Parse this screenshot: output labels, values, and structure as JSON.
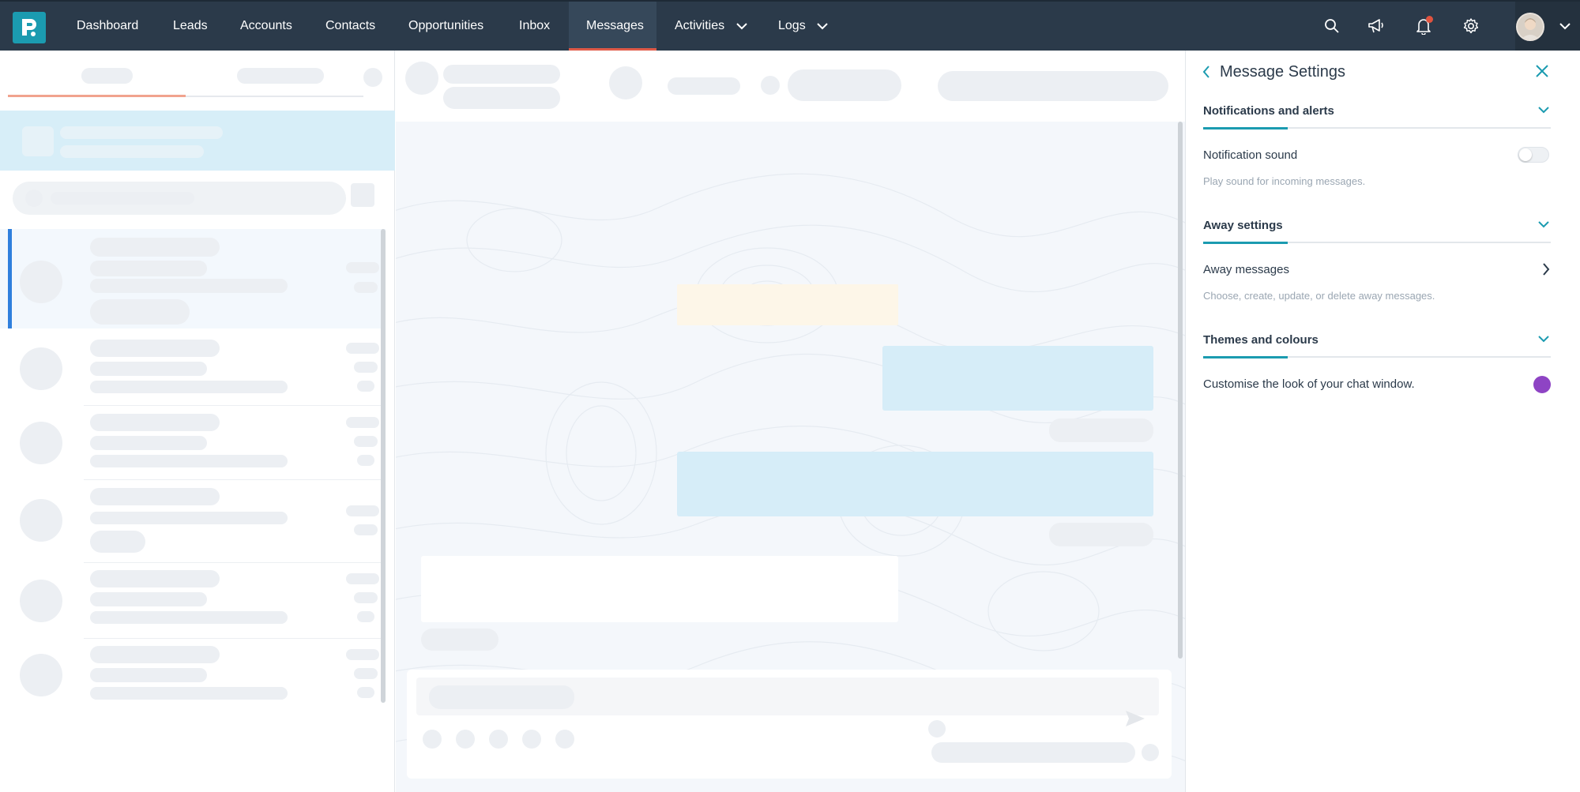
{
  "nav": {
    "items": [
      {
        "label": "Dashboard"
      },
      {
        "label": "Leads"
      },
      {
        "label": "Accounts"
      },
      {
        "label": "Contacts"
      },
      {
        "label": "Opportunities"
      },
      {
        "label": "Inbox"
      },
      {
        "label": "Messages",
        "active": true
      },
      {
        "label": "Activities",
        "dropdown": true
      },
      {
        "label": "Logs",
        "dropdown": true
      }
    ],
    "icons": [
      "search-icon",
      "megaphone-icon",
      "bell-icon",
      "gear-icon"
    ],
    "colors": {
      "bar": "#2b3a4a",
      "logo": "#1b9bb0",
      "active_underline": "#e05a47",
      "notification_dot": "#e0533f"
    }
  },
  "settings": {
    "title": "Message Settings",
    "sections": [
      {
        "title": "Notifications and alerts",
        "rows": [
          {
            "label": "Notification sound",
            "description": "Play sound for incoming messages.",
            "control": "toggle",
            "on": false
          }
        ]
      },
      {
        "title": "Away settings",
        "rows": [
          {
            "label": "Away messages",
            "description": "Choose, create, update, or delete away messages.",
            "control": "chevron-right-icon"
          }
        ]
      },
      {
        "title": "Themes and colours",
        "rows": [
          {
            "label": "Customise the look of your chat window.",
            "control": "color-swatch",
            "color": "#8e44c4"
          }
        ]
      }
    ],
    "accent": "#1b9bb0"
  }
}
